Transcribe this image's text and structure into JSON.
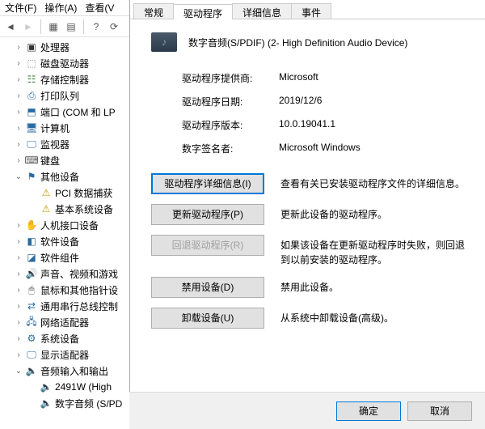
{
  "menu": {
    "file": "文件(F)",
    "action": "操作(A)",
    "view": "查看(V"
  },
  "tree": [
    {
      "indent": 16,
      "twisty": ">",
      "icon": "cpu",
      "color": "#333",
      "label": "处理器"
    },
    {
      "indent": 16,
      "twisty": ">",
      "icon": "disk",
      "color": "#888",
      "label": "磁盘驱动器"
    },
    {
      "indent": 16,
      "twisty": ">",
      "icon": "storage",
      "color": "#3a7d3a",
      "label": "存储控制器"
    },
    {
      "indent": 16,
      "twisty": ">",
      "icon": "printer",
      "color": "#2a6aa0",
      "label": "打印队列"
    },
    {
      "indent": 16,
      "twisty": ">",
      "icon": "port",
      "color": "#2a6aa0",
      "label": "端口 (COM 和 LP"
    },
    {
      "indent": 16,
      "twisty": ">",
      "icon": "computer",
      "color": "#2a6aa0",
      "label": "计算机"
    },
    {
      "indent": 16,
      "twisty": ">",
      "icon": "monitor",
      "color": "#2a6aa0",
      "label": "监视器"
    },
    {
      "indent": 16,
      "twisty": ">",
      "icon": "keyboard",
      "color": "#555",
      "label": "键盘"
    },
    {
      "indent": 16,
      "twisty": "v",
      "icon": "other",
      "color": "#2a6aa0",
      "label": "其他设备"
    },
    {
      "indent": 34,
      "twisty": "",
      "icon": "warn",
      "color": "#c69a00",
      "label": "PCI 数据捕获"
    },
    {
      "indent": 34,
      "twisty": "",
      "icon": "warn",
      "color": "#c69a00",
      "label": "基本系统设备"
    },
    {
      "indent": 16,
      "twisty": ">",
      "icon": "hid",
      "color": "#555",
      "label": "人机接口设备"
    },
    {
      "indent": 16,
      "twisty": ">",
      "icon": "sw",
      "color": "#2a6aa0",
      "label": "软件设备"
    },
    {
      "indent": 16,
      "twisty": ">",
      "icon": "swcomp",
      "color": "#2a6aa0",
      "label": "软件组件"
    },
    {
      "indent": 16,
      "twisty": ">",
      "icon": "audio",
      "color": "#3a7d3a",
      "label": "声音、视频和游戏"
    },
    {
      "indent": 16,
      "twisty": ">",
      "icon": "mouse",
      "color": "#555",
      "label": "鼠标和其他指针设"
    },
    {
      "indent": 16,
      "twisty": ">",
      "icon": "usb",
      "color": "#2a6aa0",
      "label": "通用串行总线控制"
    },
    {
      "indent": 16,
      "twisty": ">",
      "icon": "net",
      "color": "#2a6aa0",
      "label": "网络适配器"
    },
    {
      "indent": 16,
      "twisty": ">",
      "icon": "sys",
      "color": "#2a6aa0",
      "label": "系统设备"
    },
    {
      "indent": 16,
      "twisty": ">",
      "icon": "display",
      "color": "#2a6aa0",
      "label": "显示适配器"
    },
    {
      "indent": 16,
      "twisty": "v",
      "icon": "audout",
      "color": "#555",
      "label": "音频输入和输出"
    },
    {
      "indent": 34,
      "twisty": "",
      "icon": "speaker",
      "color": "#555",
      "label": "2491W (High"
    },
    {
      "indent": 34,
      "twisty": "",
      "icon": "speaker",
      "color": "#555",
      "label": "数字音频 (S/PD"
    }
  ],
  "tabs": {
    "general": "常规",
    "driver": "驱动程序",
    "details": "详细信息",
    "events": "事件"
  },
  "device": {
    "title": "数字音频(S/PDIF) (2- High Definition Audio Device)"
  },
  "info": {
    "providerLabel": "驱动程序提供商:",
    "provider": "Microsoft",
    "dateLabel": "驱动程序日期:",
    "date": "2019/12/6",
    "versionLabel": "驱动程序版本:",
    "version": "10.0.19041.1",
    "signerLabel": "数字签名者:",
    "signer": "Microsoft Windows"
  },
  "buttons": {
    "details": {
      "label": "驱动程序详细信息(I)",
      "desc": "查看有关已安装驱动程序文件的详细信息。"
    },
    "update": {
      "label": "更新驱动程序(P)",
      "desc": "更新此设备的驱动程序。"
    },
    "rollback": {
      "label": "回退驱动程序(R)",
      "desc": "如果该设备在更新驱动程序时失败，则回退到以前安装的驱动程序。"
    },
    "disable": {
      "label": "禁用设备(D)",
      "desc": "禁用此设备。"
    },
    "uninstall": {
      "label": "卸载设备(U)",
      "desc": "从系统中卸载设备(高级)。"
    }
  },
  "footer": {
    "ok": "确定",
    "cancel": "取消"
  }
}
